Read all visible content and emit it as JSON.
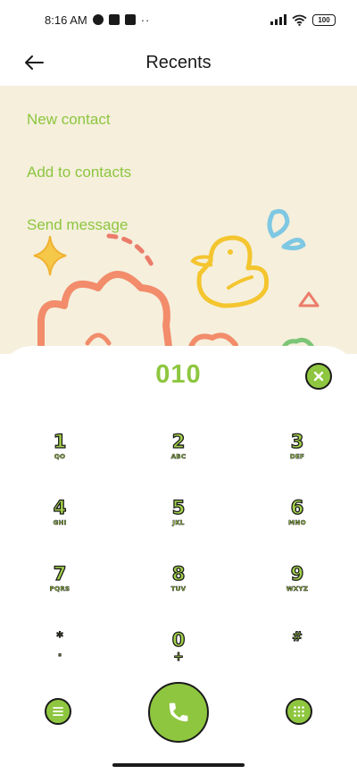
{
  "status_bar": {
    "time": "8:16 AM",
    "dots": "··",
    "battery": "100"
  },
  "header": {
    "title": "Recents"
  },
  "actions": [
    {
      "label": "New contact"
    },
    {
      "label": "Add to contacts"
    },
    {
      "label": "Send message"
    }
  ],
  "dialer": {
    "number": "010",
    "keys": [
      {
        "digit": "1",
        "letters": "QO"
      },
      {
        "digit": "2",
        "letters": "ABC"
      },
      {
        "digit": "3",
        "letters": "DEF"
      },
      {
        "digit": "4",
        "letters": "GHI"
      },
      {
        "digit": "5",
        "letters": "JKL"
      },
      {
        "digit": "6",
        "letters": "MNO"
      },
      {
        "digit": "7",
        "letters": "PQRS"
      },
      {
        "digit": "8",
        "letters": "TUV"
      },
      {
        "digit": "9",
        "letters": "WXYZ"
      },
      {
        "digit": "*",
        "letters": "·"
      },
      {
        "digit": "0",
        "letters": "+"
      },
      {
        "digit": "#",
        "letters": ""
      }
    ]
  },
  "colors": {
    "accent": "#8ec63f",
    "background": "#f5efdc",
    "outline": "#1a1a1a"
  },
  "icons": {
    "back": "arrow-left-icon",
    "clear": "close-icon",
    "menu": "menu-icon",
    "call": "phone-icon",
    "dialpad": "dialpad-icon"
  }
}
